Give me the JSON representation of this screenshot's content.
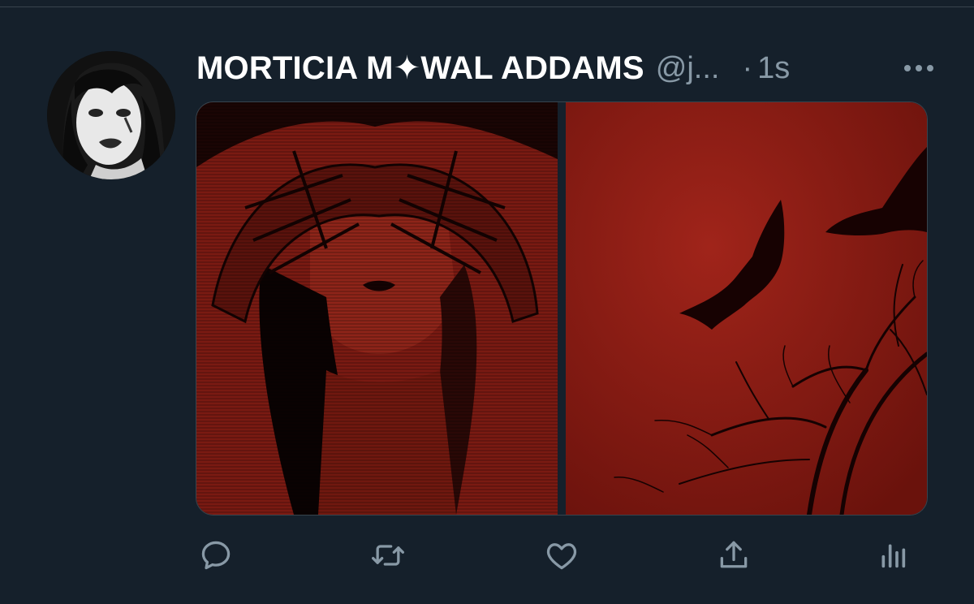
{
  "tweet": {
    "display_name": "MORTICIA M✦WAL ADDAMS",
    "handle": "@j...",
    "separator": "·",
    "timestamp": "1s",
    "more_icon": "more-horizontal-icon",
    "avatar_alt": "profile avatar"
  },
  "media": {
    "count": 2,
    "tint_color": "#8b1a12",
    "images": [
      {
        "name": "covered-eyes-illustration"
      },
      {
        "name": "bats-red-sky"
      }
    ]
  },
  "actions": [
    {
      "icon": "reply-icon"
    },
    {
      "icon": "retweet-icon"
    },
    {
      "icon": "like-icon"
    },
    {
      "icon": "share-icon"
    },
    {
      "icon": "analytics-icon"
    }
  ],
  "colors": {
    "background": "#15202b",
    "text_primary": "#ffffff",
    "text_secondary": "#8899a6",
    "divider": "#38444d"
  }
}
